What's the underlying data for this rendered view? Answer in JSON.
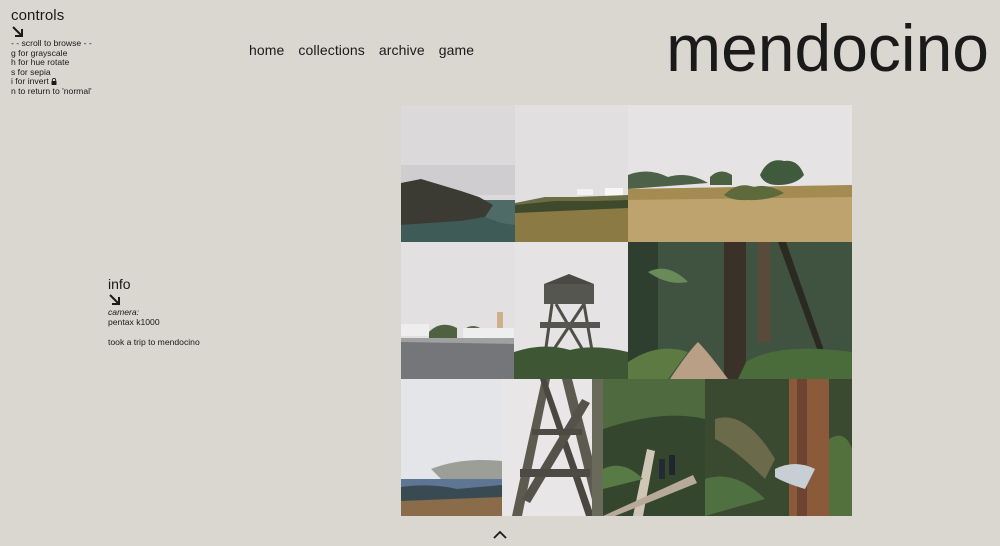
{
  "controls": {
    "title": "controls",
    "lines": [
      "- - scroll to browse - -",
      "g for grayscale",
      "h for hue rotate",
      "s for sepia",
      "i for invert",
      "n to return to 'normal'"
    ]
  },
  "nav": {
    "items": [
      "home",
      "collections",
      "archive",
      "game"
    ]
  },
  "brand": "mendocino",
  "info": {
    "title": "info",
    "camera_label": "camera:",
    "camera_value": "pentax k1000",
    "description": "took a trip to mendocino"
  },
  "colors": {
    "background": "#dad6d0",
    "text": "#1a1a1a"
  },
  "icons": {
    "controls_arrow": "arrow-down-right-icon",
    "info_arrow": "arrow-down-right-icon",
    "invert_lock": "lock-icon",
    "scroll_up": "chevron-up-icon"
  }
}
